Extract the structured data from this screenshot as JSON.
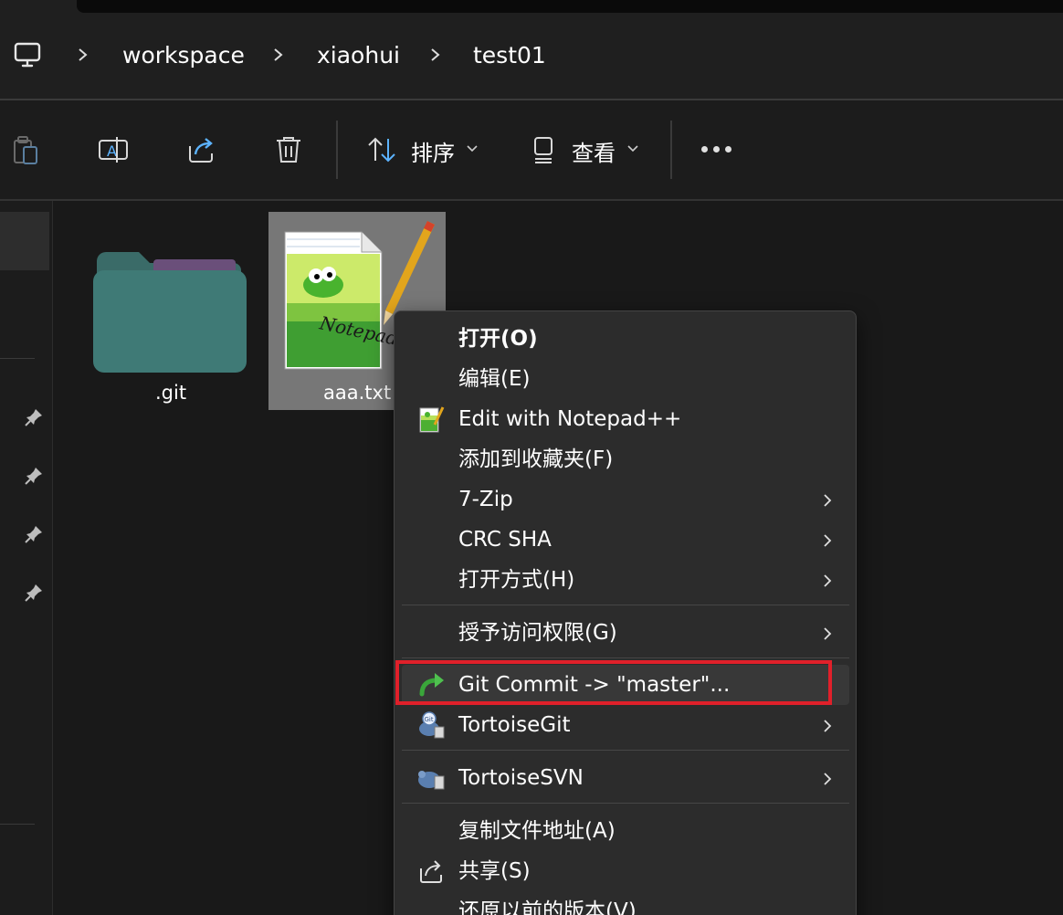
{
  "breadcrumb": {
    "items": [
      "workspace",
      "xiaohui",
      "test01"
    ]
  },
  "toolbar": {
    "sort_label": "排序",
    "view_label": "查看"
  },
  "files": [
    {
      "name": ".git",
      "type": "folder"
    },
    {
      "name": "aaa.txt",
      "type": "text-file",
      "selected": true
    }
  ],
  "context_menu": {
    "items": [
      {
        "label": "打开(O)",
        "bold": true,
        "icon": "",
        "submenu": false
      },
      {
        "label": "编辑(E)",
        "bold": false,
        "icon": "",
        "submenu": false
      },
      {
        "label": "Edit with Notepad++",
        "bold": false,
        "icon": "notepadpp-icon",
        "submenu": false
      },
      {
        "label": "添加到收藏夹(F)",
        "bold": false,
        "icon": "",
        "submenu": false
      },
      {
        "label": "7-Zip",
        "bold": false,
        "icon": "",
        "submenu": true
      },
      {
        "label": "CRC SHA",
        "bold": false,
        "icon": "",
        "submenu": true
      },
      {
        "label": "打开方式(H)",
        "bold": false,
        "icon": "",
        "submenu": true
      },
      {
        "label": "授予访问权限(G)",
        "bold": false,
        "icon": "",
        "submenu": true
      },
      {
        "label": "Git Commit -> \"master\"...",
        "bold": false,
        "icon": "git-commit-icon",
        "submenu": false,
        "highlighted": true
      },
      {
        "label": "TortoiseGit",
        "bold": false,
        "icon": "tortoisegit-icon",
        "submenu": true
      },
      {
        "label": "TortoiseSVN",
        "bold": false,
        "icon": "tortoisesvn-icon",
        "submenu": true
      },
      {
        "label": "复制文件地址(A)",
        "bold": false,
        "icon": "",
        "submenu": false
      },
      {
        "label": "共享(S)",
        "bold": false,
        "icon": "share-icon",
        "submenu": false
      },
      {
        "label": "还原以前的版本(V)",
        "bold": false,
        "icon": "",
        "submenu": false
      }
    ]
  },
  "colors": {
    "highlight_border": "#e0202a",
    "folder": "#3f7a76",
    "accent_blue": "#5cb3ff"
  }
}
